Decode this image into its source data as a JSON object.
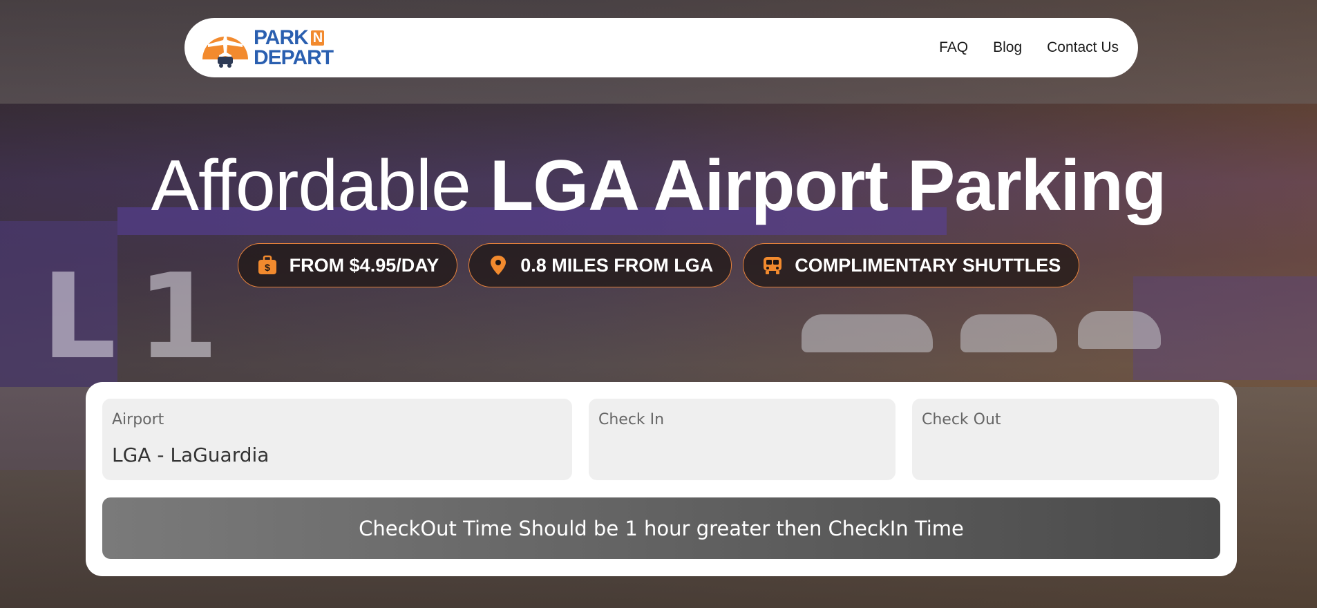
{
  "navbar": {
    "logo": {
      "line1": "PARK",
      "n": "N",
      "line2": "DEPART"
    },
    "links": [
      "FAQ",
      "Blog",
      "Contact Us"
    ]
  },
  "hero": {
    "title_light": "Affordable",
    "title_bold": "LGA Airport Parking",
    "features": [
      {
        "icon": "wallet-dollar-icon",
        "text": "FROM $4.95/DAY"
      },
      {
        "icon": "location-pin-icon",
        "text": "0.8 MILES FROM LGA"
      },
      {
        "icon": "shuttle-bus-icon",
        "text": "COMPLIMENTARY SHUTTLES"
      }
    ]
  },
  "booking": {
    "airport": {
      "label": "Airport",
      "value": "LGA - LaGuardia"
    },
    "check_in": {
      "label": "Check In",
      "value": ""
    },
    "check_out": {
      "label": "Check Out",
      "value": ""
    },
    "warning": "CheckOut Time Should be 1 hour greater then CheckIn Time"
  },
  "colors": {
    "accent": "#f28a2e",
    "brand_blue": "#2a5fb0",
    "pill_border": "#e8823a"
  }
}
